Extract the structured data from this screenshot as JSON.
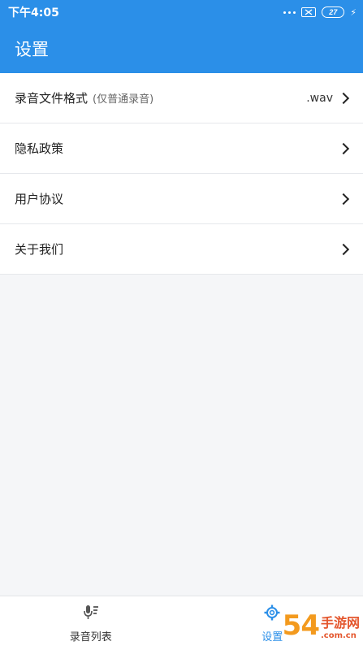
{
  "status_bar": {
    "time": "下午4:05",
    "battery": "27"
  },
  "app_bar": {
    "title": "设置"
  },
  "settings": {
    "items": [
      {
        "label": "录音文件格式",
        "note": "(仅普通录音)",
        "value": ".wav"
      },
      {
        "label": "隐私政策",
        "note": "",
        "value": ""
      },
      {
        "label": "用户协议",
        "note": "",
        "value": ""
      },
      {
        "label": "关于我们",
        "note": "",
        "value": ""
      }
    ]
  },
  "bottom_nav": {
    "items": [
      {
        "label": "录音列表",
        "icon": "mic-list-icon"
      },
      {
        "label": "设置",
        "icon": "gear-icon"
      }
    ],
    "active_color": "#2b8fe8"
  },
  "watermark": {
    "brand": "54",
    "cn": "手游网",
    "url": ".com.cn"
  },
  "colors": {
    "primary": "#2b8fe8",
    "background": "#f5f6f8"
  }
}
